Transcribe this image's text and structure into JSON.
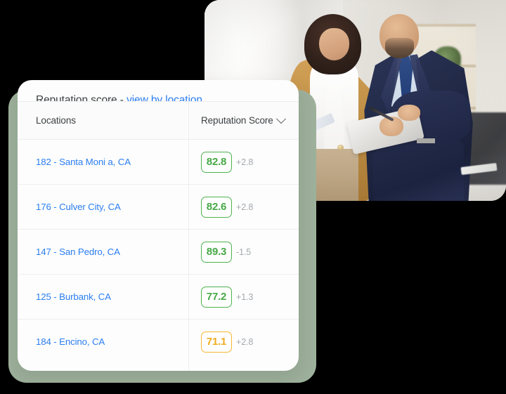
{
  "card": {
    "title_prefix": "Reputation score - ",
    "title_link": "view by location",
    "columns": {
      "locations": "Locations",
      "reputation_score": "Reputation Score",
      "sort_icon": "chevron-down-icon"
    },
    "rows": [
      {
        "location": "182 - Santa Moni a, CA",
        "score": "82.8",
        "delta": "+2.8",
        "status": "good"
      },
      {
        "location": "176 - Culver City, CA",
        "score": "82.6",
        "delta": "+2.8",
        "status": "good"
      },
      {
        "location": "147 - San Pedro, CA",
        "score": "89.3",
        "delta": "-1.5",
        "status": "good"
      },
      {
        "location": "125 - Burbank, CA",
        "score": "77.2",
        "delta": "+1.3",
        "status": "good"
      },
      {
        "location": "184 - Encino, CA",
        "score": "71.1",
        "delta": "+2.8",
        "status": "warn"
      }
    ]
  },
  "colors": {
    "link_blue": "#2b7ef0",
    "score_good": "#46a846",
    "score_good_border": "#4eb24e",
    "score_warn": "#f0ab1f",
    "score_warn_border": "#f5b731",
    "delta_gray": "#a3a8ad",
    "backdrop_green": "#9db09b",
    "card_white": "#fdfdfd",
    "text_dark": "#3c4043"
  },
  "photo": {
    "alt": "two business professionals reviewing a tablet in a bright office"
  }
}
